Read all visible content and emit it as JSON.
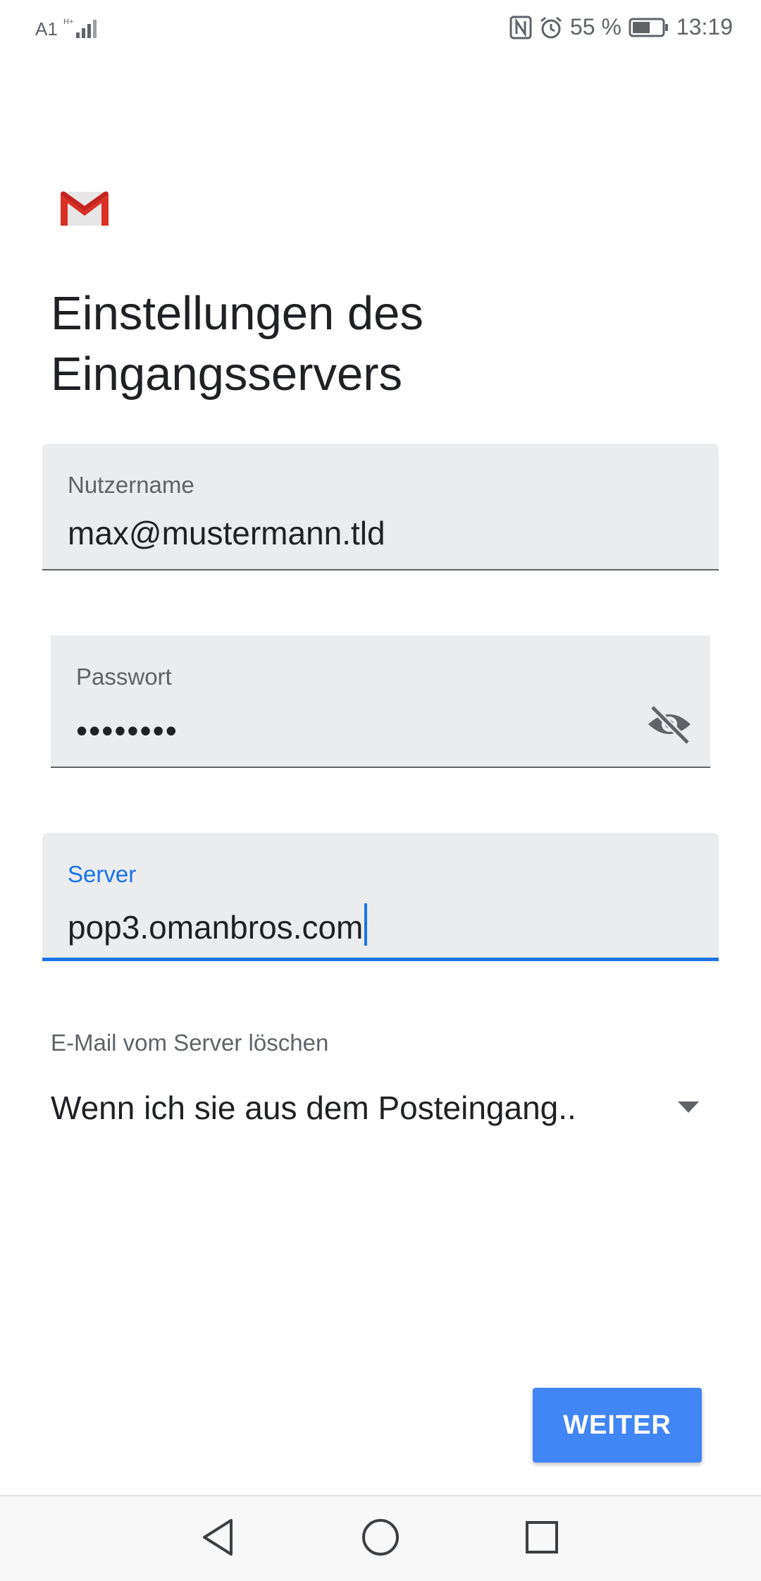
{
  "status_bar": {
    "carrier": "A1",
    "battery": "55 %",
    "time": "13:19",
    "icons": [
      "signal-icon",
      "nfc-icon",
      "alarm-icon",
      "battery-icon"
    ]
  },
  "app": {
    "logo": "gmail-icon",
    "title_line1": "Einstellungen des",
    "title_line2": "Eingangsservers"
  },
  "form": {
    "username": {
      "label": "Nutzername",
      "value": "max@mustermann.tld"
    },
    "password": {
      "label": "Passwort",
      "value": "••••••••"
    },
    "server": {
      "label": "Server",
      "value": "pop3.omanbros.com"
    },
    "delete_from_server": {
      "label": "E-Mail vom Server löschen",
      "selected": "Wenn ich sie aus dem Posteingang.."
    }
  },
  "actions": {
    "next_label": "WEITER"
  },
  "colors": {
    "accent": "#1a73e8",
    "button": "#4285f4",
    "field_bg": "#ebeced"
  },
  "nav_bar": {
    "icons": [
      "back-icon",
      "home-icon",
      "recents-icon"
    ]
  }
}
